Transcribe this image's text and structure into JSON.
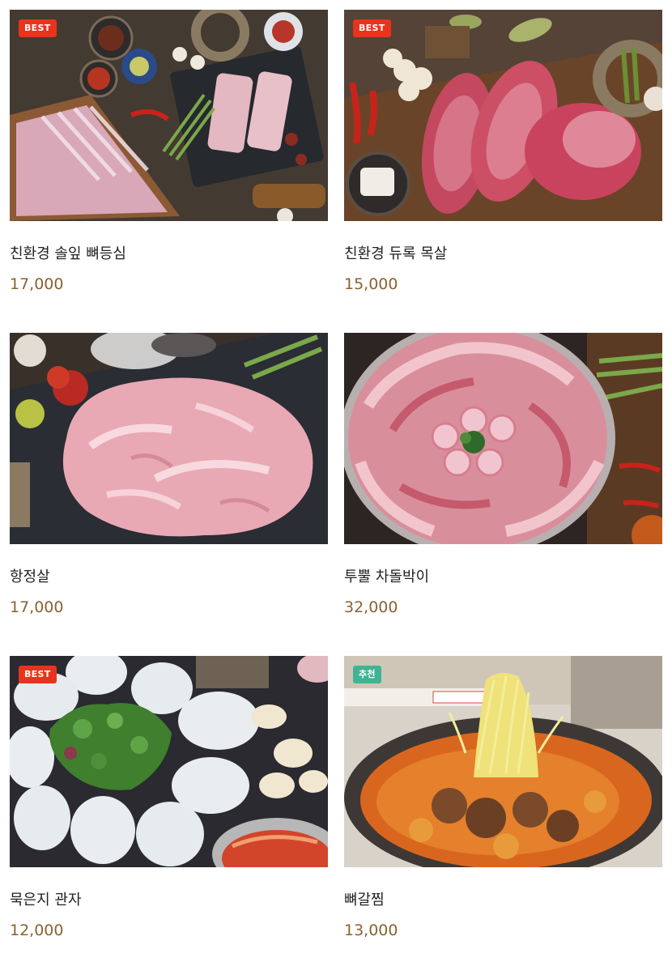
{
  "colors": {
    "badge_best": "#e8341c",
    "badge_recommend": "#3fb493",
    "price": "#8a6230",
    "name": "#222222"
  },
  "products": [
    {
      "name": "친환경 솔잎 뼈등심",
      "price": "17,000",
      "badge": "BEST",
      "image": "pork-rack-ribs-image"
    },
    {
      "name": "친환경 듀록 목살",
      "price": "15,000",
      "badge": "BEST",
      "image": "pork-neck-steaks-image"
    },
    {
      "name": "항정살",
      "price": "17,000",
      "badge": "",
      "image": "pork-jowl-image"
    },
    {
      "name": "투뿔 차돌박이",
      "price": "32,000",
      "badge": "",
      "image": "beef-brisket-plate-image"
    },
    {
      "name": "묵은지 관자",
      "price": "12,000",
      "badge": "BEST",
      "image": "scallop-kimchi-image"
    },
    {
      "name": "뼈갈찜",
      "price": "13,000",
      "badge": "추천",
      "image": "braised-rib-stew-image"
    }
  ]
}
